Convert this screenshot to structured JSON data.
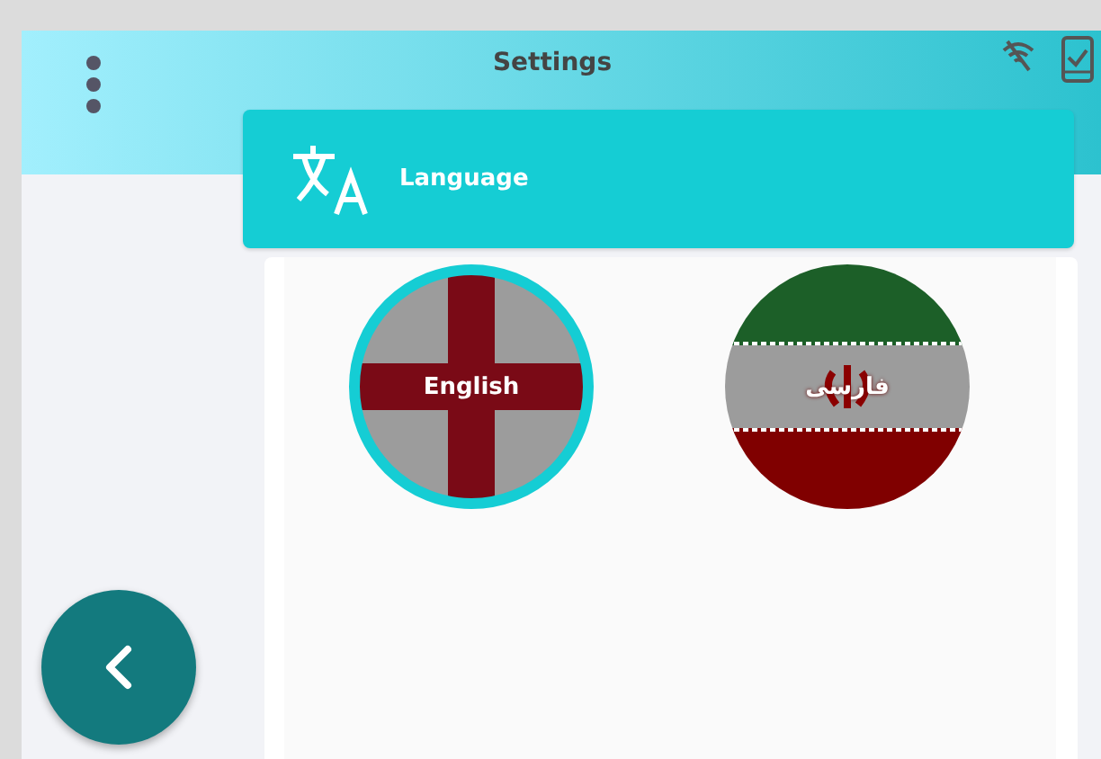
{
  "header": {
    "title": "Settings"
  },
  "section": {
    "title": "Language"
  },
  "languages": [
    {
      "label": "English",
      "kind": "cross",
      "selected": true
    },
    {
      "label": "فارسی",
      "kind": "tricolor",
      "selected": false
    }
  ]
}
